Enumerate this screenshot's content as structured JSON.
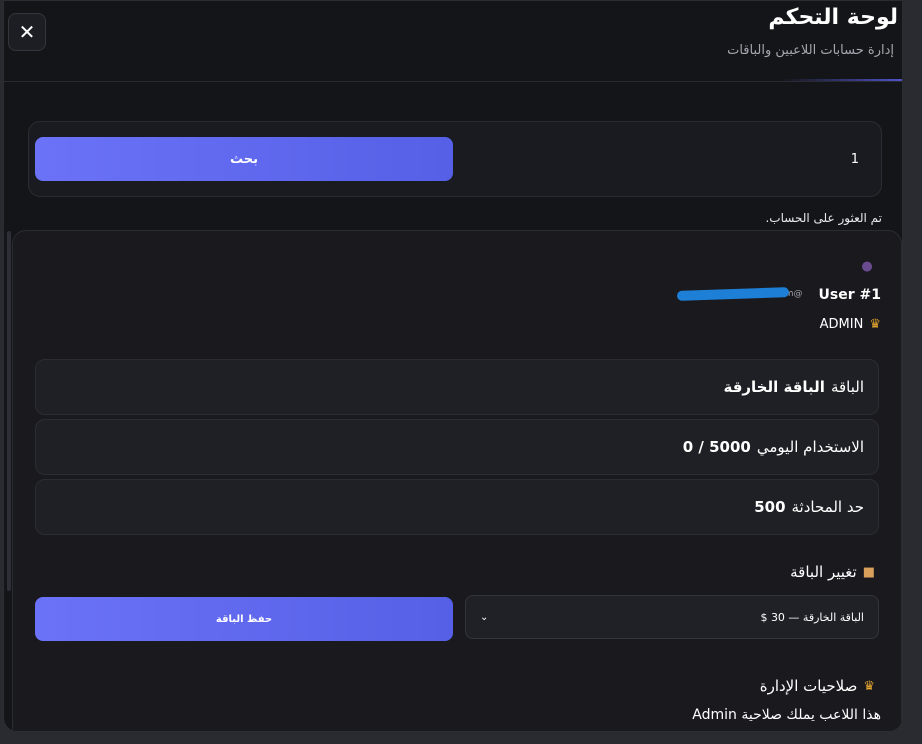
{
  "header": {
    "title": "لوحة التحكم",
    "subtitle": "إدارة حسابات اللاعبين والباقات",
    "close_icon": "close-icon"
  },
  "search": {
    "value": "1",
    "button_label": "بحث"
  },
  "found_message": "تم العثور على الحساب.",
  "user": {
    "name": "User #1",
    "email_visible": "@gmail.com",
    "role": "ADMIN"
  },
  "stats": {
    "plan_label": "الباقة",
    "plan_value": "الباقة الخارقة",
    "usage_label": "الاستخدام اليومي",
    "usage_value": "0 / 5000",
    "chat_limit_label": "حد المحادثة",
    "chat_limit_value": "500"
  },
  "change_plan": {
    "title": "تغيير الباقة",
    "selected_option": "الباقة الخارقة — 30 $",
    "save_label": "حفظ الباقة"
  },
  "admin": {
    "title": "صلاحيات الإدارة",
    "note": "هذا اللاعب يملك صلاحية Admin"
  },
  "colors": {
    "accent": "#6366f1",
    "background": "#141519",
    "crown": "#e3a72f"
  }
}
